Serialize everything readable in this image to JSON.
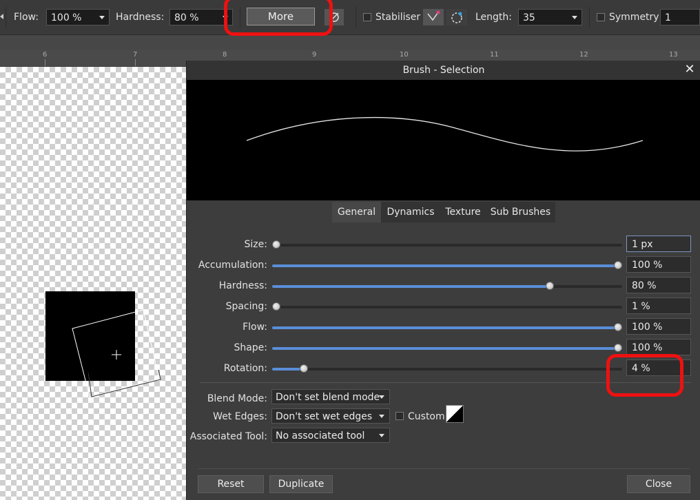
{
  "toolbar": {
    "flow_label": "Flow:",
    "flow_value": "100 %",
    "hardness_label": "Hardness:",
    "hardness_value": "80 %",
    "more_label": "More",
    "stabiliser_label": "Stabiliser",
    "length_label": "Length:",
    "length_value": "35",
    "symmetry_label": "Symmetry",
    "symmetry_value": "1"
  },
  "ruler": {
    "ticks": [
      "6",
      "7",
      "8",
      "9",
      "10",
      "11",
      "12",
      "13"
    ]
  },
  "dialog": {
    "title": "Brush - Selection",
    "tabs": [
      "General",
      "Dynamics",
      "Texture",
      "Sub Brushes"
    ],
    "active_tab": "General",
    "sliders": [
      {
        "label": "Size:",
        "value": "1 px",
        "level": 0.0
      },
      {
        "label": "Accumulation:",
        "value": "100 %",
        "level": 1.0
      },
      {
        "label": "Hardness:",
        "value": "80 %",
        "level": 0.8
      },
      {
        "label": "Spacing:",
        "value": "1 %",
        "level": 0.0
      },
      {
        "label": "Flow:",
        "value": "100 %",
        "level": 1.0
      },
      {
        "label": "Shape:",
        "value": "100 %",
        "level": 1.0
      },
      {
        "label": "Rotation:",
        "value": "4 %",
        "level": 0.08
      }
    ],
    "blend_mode_label": "Blend Mode:",
    "blend_mode_value": "Don't set blend mode",
    "wet_edges_label": "Wet Edges:",
    "wet_edges_value": "Don't set wet edges",
    "custom_label": "Custom",
    "associated_tool_label": "Associated Tool:",
    "associated_tool_value": "No associated tool",
    "reset_label": "Reset",
    "duplicate_label": "Duplicate",
    "close_label": "Close"
  },
  "colors": {
    "accent": "#5a8ed8",
    "highlight": "#ee1111",
    "background": "#474747",
    "dialog": "#3d3d3d"
  }
}
